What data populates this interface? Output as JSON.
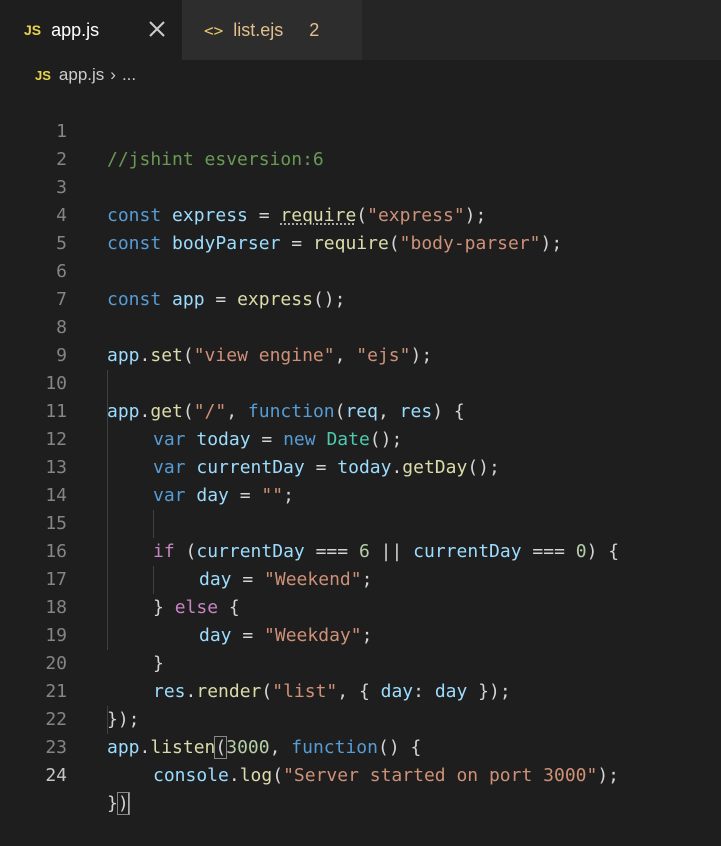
{
  "tabs": [
    {
      "badge": "JS",
      "label": "app.js",
      "close": "✕"
    },
    {
      "icon": "<>",
      "label": "list.ejs",
      "problems": "2"
    }
  ],
  "breadcrumb": {
    "badge": "JS",
    "file": "app.js",
    "sep": "›",
    "more": "..."
  },
  "line_numbers": [
    "1",
    "2",
    "3",
    "4",
    "5",
    "6",
    "7",
    "8",
    "9",
    "10",
    "11",
    "12",
    "13",
    "14",
    "15",
    "16",
    "17",
    "18",
    "19",
    "20",
    "21",
    "22",
    "23",
    "24"
  ],
  "code": {
    "l1": "//jshint esversion:6",
    "l3": [
      "const",
      "express",
      "=",
      "require",
      "(",
      "\"express\"",
      ");"
    ],
    "l4": [
      "const",
      "bodyParser",
      "=",
      "require",
      "(",
      "\"body-parser\"",
      ");"
    ],
    "l6": [
      "const",
      "app",
      "=",
      "express",
      "();"
    ],
    "l8": [
      "app",
      ".",
      "set",
      "(",
      "\"view engine\"",
      ", ",
      "\"ejs\"",
      ");"
    ],
    "l10": [
      "app",
      ".",
      "get",
      "(",
      "\"/\"",
      ", ",
      "function",
      "(",
      "req",
      ", ",
      "res",
      ") {"
    ],
    "l11": [
      "var",
      "today",
      "=",
      "new",
      "Date",
      "();"
    ],
    "l12": [
      "var",
      "currentDay",
      "=",
      "today",
      ".",
      "getDay",
      "();"
    ],
    "l13": [
      "var",
      "day",
      "=",
      "\"\"",
      ";"
    ],
    "l15": [
      "if",
      "(",
      "currentDay",
      "===",
      "6",
      "||",
      "currentDay",
      "===",
      "0",
      ") {"
    ],
    "l16": [
      "day",
      "=",
      "\"Weekend\"",
      ";"
    ],
    "l17": [
      "} ",
      "else",
      " {"
    ],
    "l18": [
      "day",
      "=",
      "\"Weekday\"",
      ";"
    ],
    "l19": "}",
    "l20": [
      "res",
      ".",
      "render",
      "(",
      "\"list\"",
      ", { ",
      "day",
      ": ",
      "day",
      " });"
    ],
    "l21": "});",
    "l22": [
      "app",
      ".",
      "listen",
      "(",
      "3000",
      ", ",
      "function",
      "() {"
    ],
    "l23": [
      "console",
      ".",
      "log",
      "(",
      "\"Server started on port 3000\"",
      ");"
    ],
    "l24": [
      "}",
      ")"
    ]
  }
}
